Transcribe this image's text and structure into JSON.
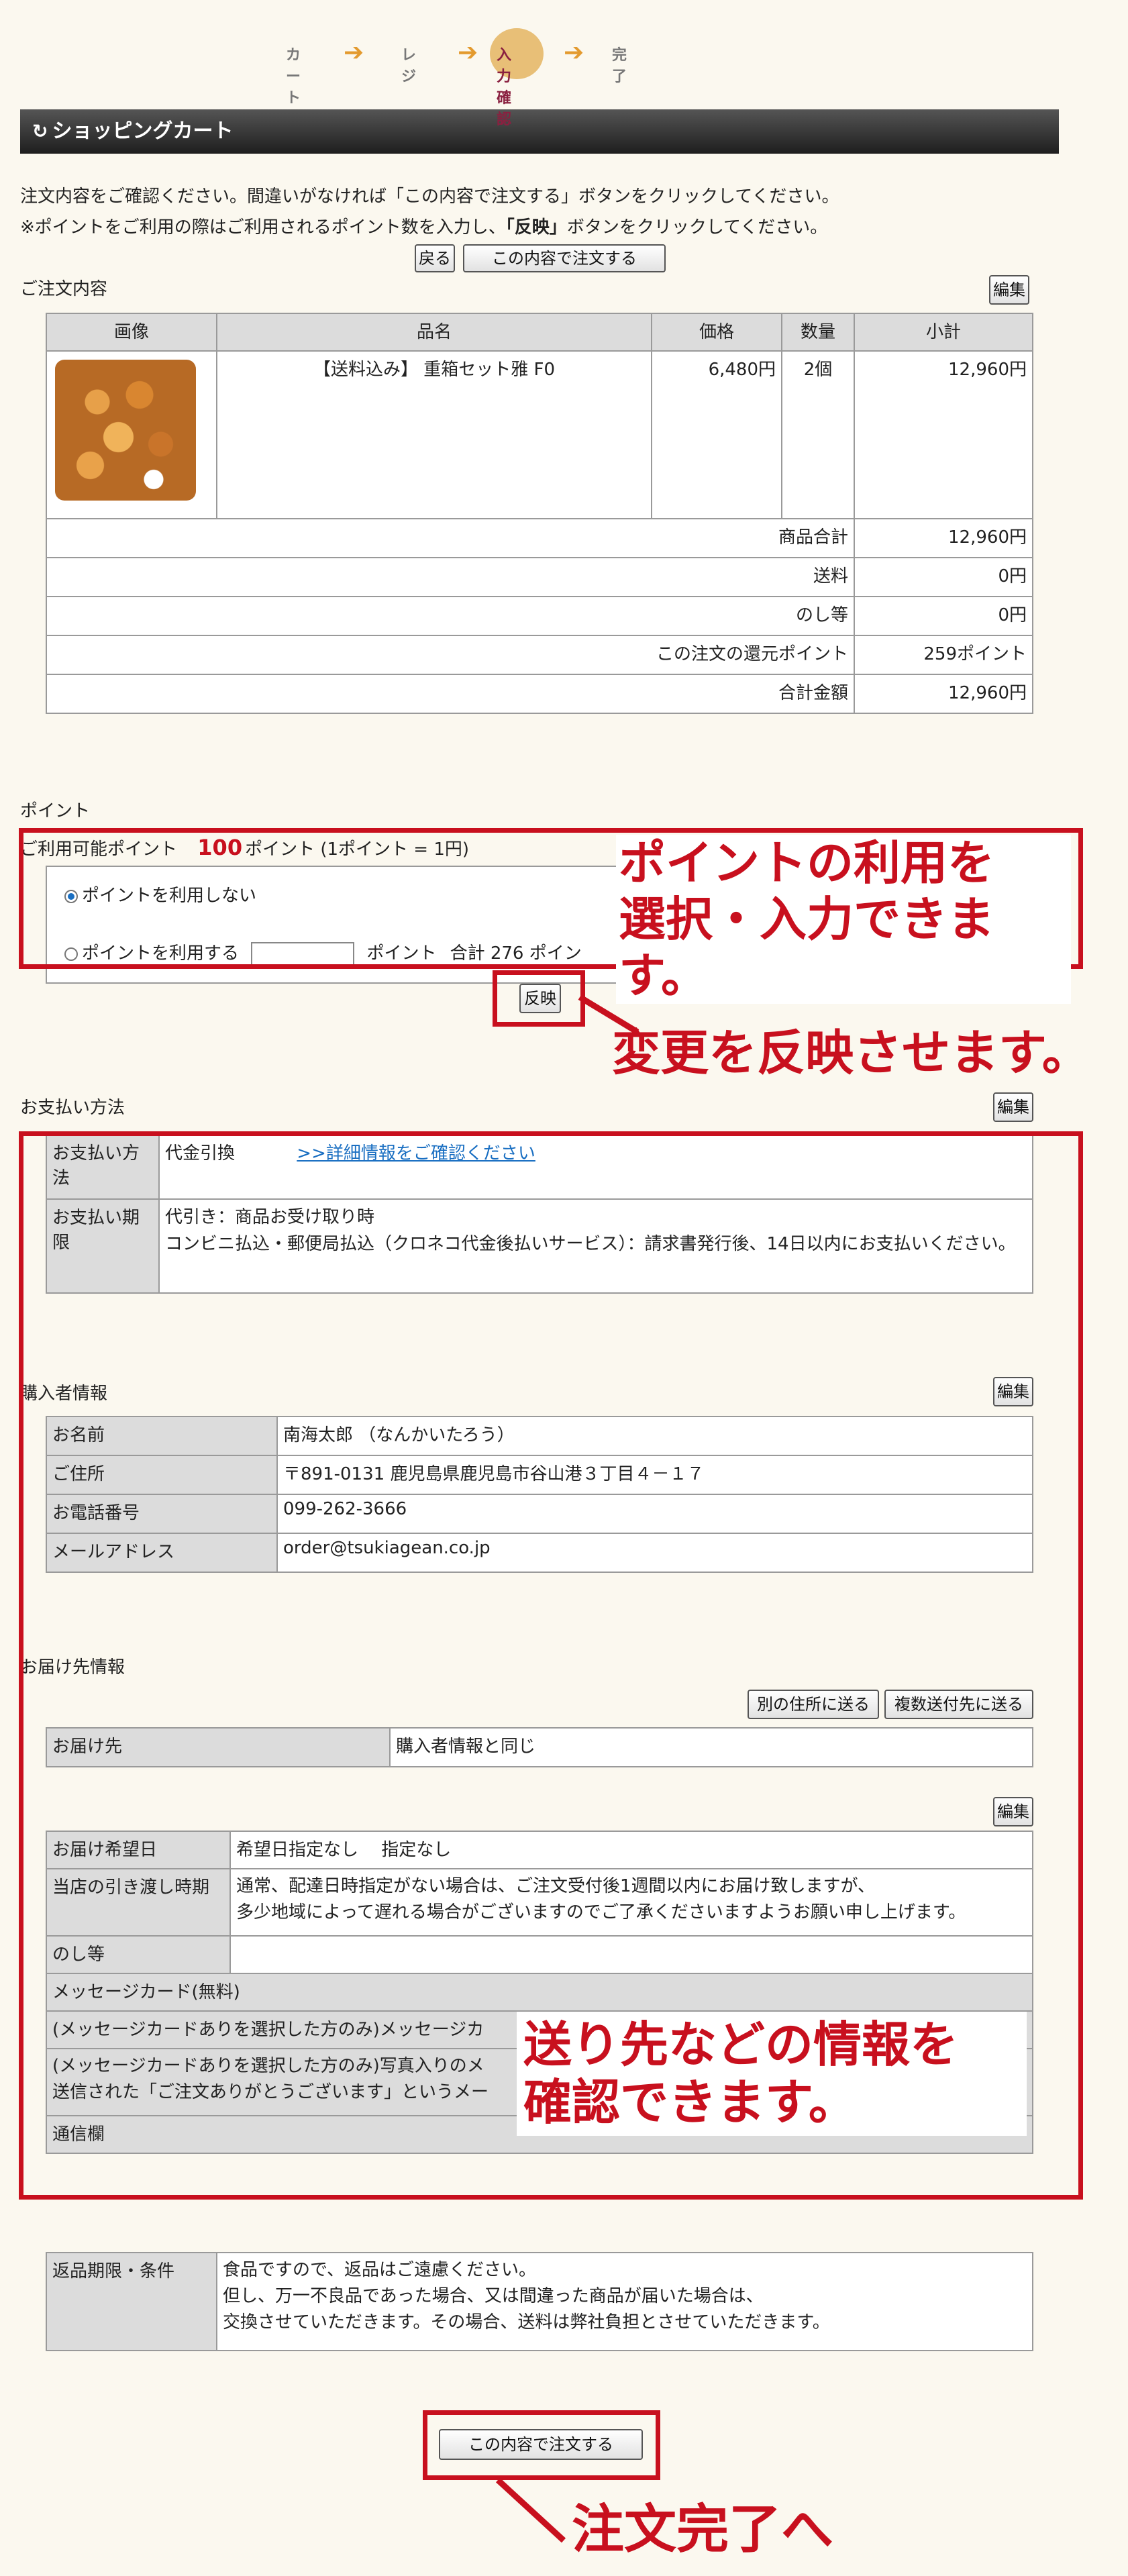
{
  "steps": [
    "カート",
    "レジ",
    "入力確認",
    "完了"
  ],
  "header": {
    "title": "ショッピングカート"
  },
  "intro": {
    "line1": "注文内容をご確認ください。間違いがなければ「この内容で注文する」ボタンをクリックしてください。",
    "line2_pre": "※ポイントをご利用の際はご利用されるポイント数を入力し、",
    "line2_bold": "「反映」",
    "line2_post": "ボタンをクリックしてください。"
  },
  "buttons": {
    "back": "戻る",
    "order": "この内容で注文する",
    "edit": "編集",
    "apply": "反映",
    "other_address": "別の住所に送る",
    "multi_address": "複数送付先に送る"
  },
  "order": {
    "label": "ご注文内容",
    "headers": [
      "画像",
      "品名",
      "価格",
      "数量",
      "小計"
    ],
    "item": {
      "name": "【送料込み】 重箱セット雅 F0",
      "price": "6,480円",
      "qty": "2個",
      "subtotal": "12,960円"
    },
    "summary": [
      {
        "label": "商品合計",
        "value": "12,960円"
      },
      {
        "label": "送料",
        "value": "0円"
      },
      {
        "label": "のし等",
        "value": "0円"
      },
      {
        "label": "この注文の還元ポイント",
        "value": "259ポイント"
      },
      {
        "label": "合計金額",
        "value": "12,960円"
      }
    ]
  },
  "points": {
    "label": "ポイント",
    "available_pre": "ご利用可能ポイント",
    "available_value": "100",
    "available_post": "ポイント (1ポイント = 1円)",
    "opt_none": "ポイントを利用しない",
    "opt_use": "ポイントを利用する",
    "unit": "ポイント",
    "total": "合計 276 ポイン"
  },
  "payment": {
    "label": "お支払い方法",
    "method_label": "お支払い方法",
    "method_value": "代金引換",
    "method_link": ">>詳細情報をご確認ください",
    "due_label": "お支払い期限",
    "due_line1": "代引き：商品お受け取り時",
    "due_line2": "コンビニ払込・郵便局払込（クロネコ代金後払いサービス）：請求書発行後、14日以内にお支払いください。"
  },
  "buyer": {
    "label": "購入者情報",
    "rows": [
      {
        "label": "お名前",
        "value": "南海太郎 （なんかいたろう）"
      },
      {
        "label": "ご住所",
        "value": "〒891-0131 鹿児島県鹿児島市谷山港３丁目４－１７"
      },
      {
        "label": "お電話番号",
        "value": "099-262-3666"
      },
      {
        "label": "メールアドレス",
        "value": "order@tsukiagean.co.jp"
      }
    ]
  },
  "delivery": {
    "label": "お届け先情報",
    "dest_label": "お届け先",
    "dest_value": "購入者情報と同じ",
    "date_label": "お届け希望日",
    "date_value": "希望日指定なし　 指定なし",
    "handover_label": "当店の引き渡し時期",
    "handover_line1": "通常、配達日時指定がない場合は、ご注文受付後1週間以内にお届け致しますが、",
    "handover_line2": "多少地域によって遅れる場合がございますのでご了承くださいますようお願い申し上げます。",
    "noshi_label": "のし等",
    "msg_card": "メッセージカード(無料)",
    "msg_line": "(メッセージカードありを選択した方のみ)メッセージカ",
    "photo_line1": "(メッセージカードありを選択した方のみ)写真入りのメ",
    "photo_line2": "送信された「ご注文ありがとうございます」というメー",
    "comm": "通信欄"
  },
  "returns": {
    "label": "返品期限・条件",
    "line1": "食品ですので、返品はご遠慮ください。",
    "line2": "但し、万一不良品であった場合、又は間違った商品が届いた場合は、",
    "line3": "交換させていただきます。その場合、送料は弊社負担とさせていただきます。"
  },
  "callouts": {
    "points_1": "ポイントの利用を",
    "points_2": "選択・入力できます。",
    "apply": "変更を反映させます。",
    "info_1": "送り先などの情報を",
    "info_2": "確認できます。",
    "complete": "注文完了へ"
  },
  "colors": {
    "accent_red": "#c8101e",
    "link_blue": "#1a6fc2",
    "step_arrow": "#e39a2e"
  }
}
